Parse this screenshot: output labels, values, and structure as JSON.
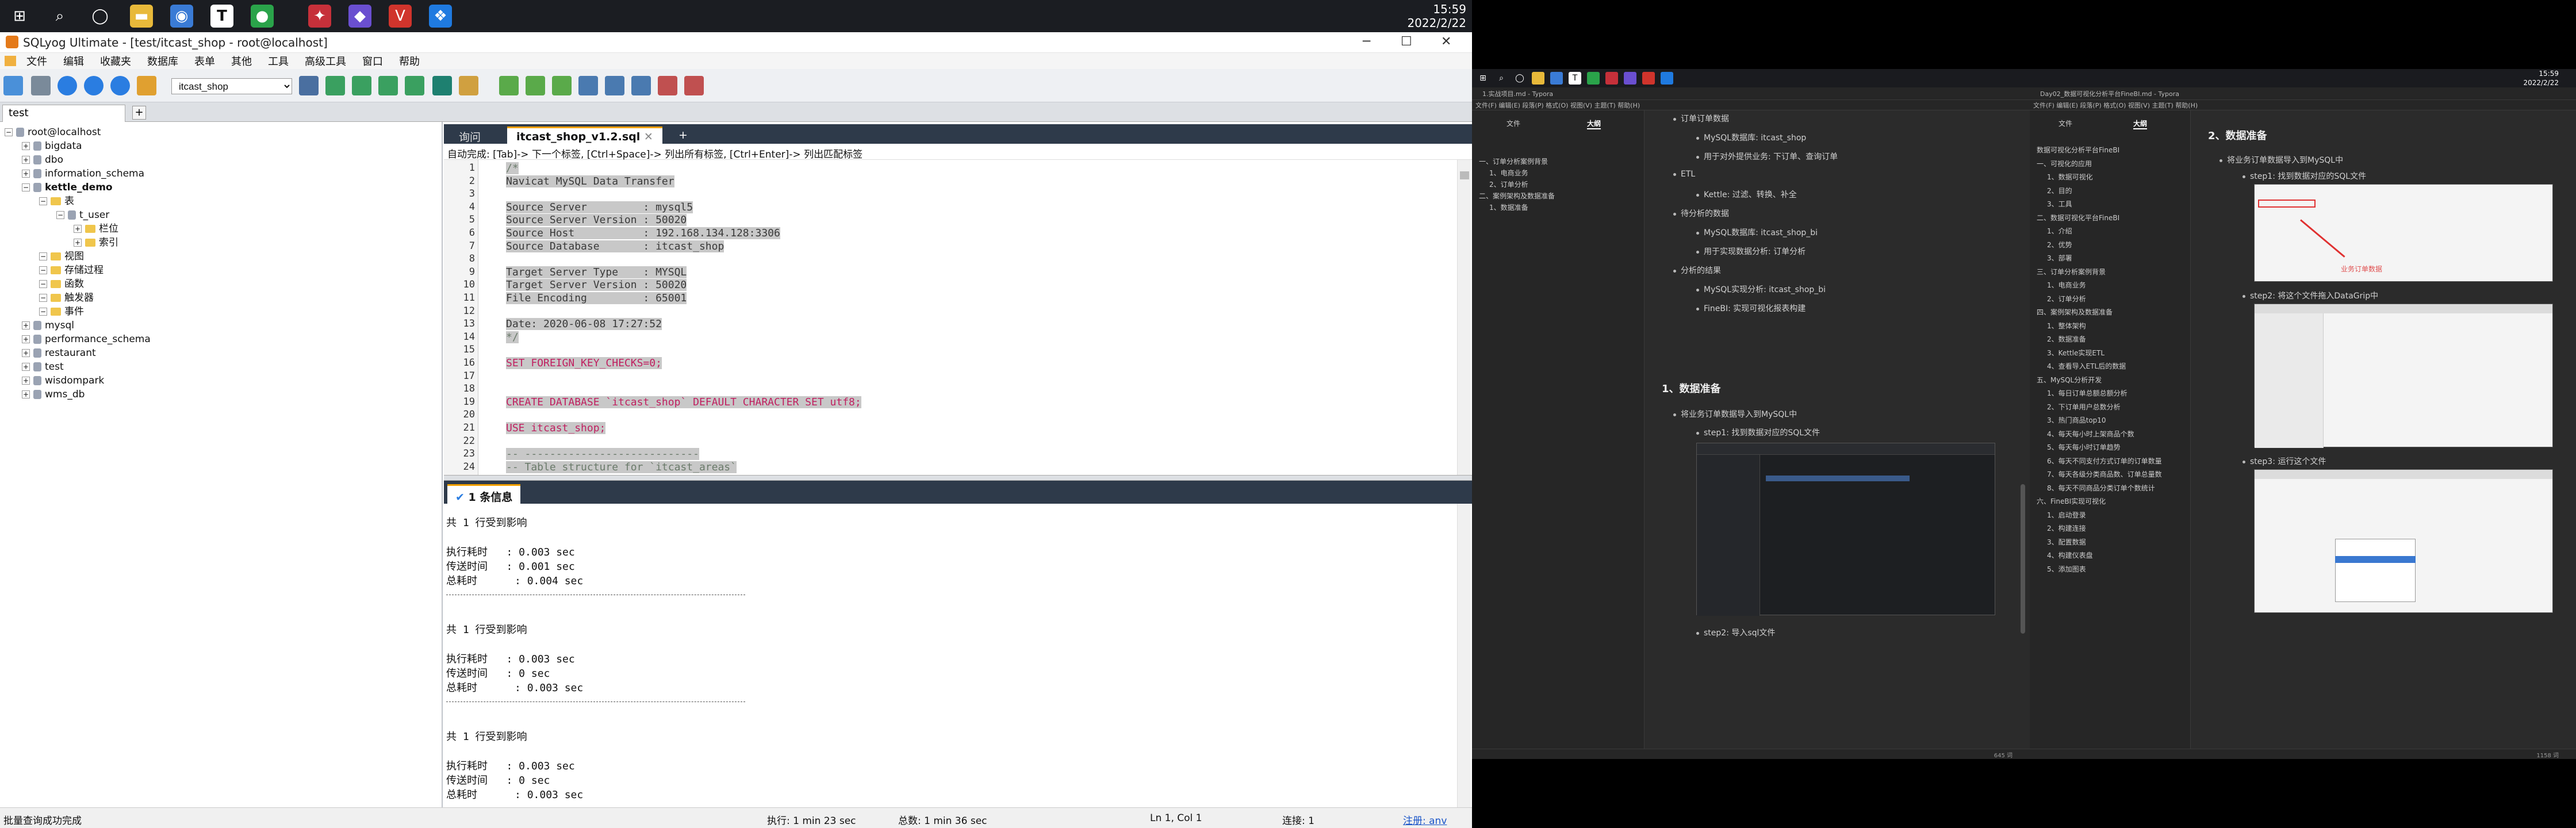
{
  "left": {
    "clock": {
      "time": "15:59",
      "date": "2022/2/22"
    },
    "title": "SQLyog Ultimate - [test/itcast_shop - root@localhost]",
    "menu": [
      "文件",
      "编辑",
      "收藏夹",
      "数据库",
      "表单",
      "其他",
      "工具",
      "高级工具",
      "窗口",
      "帮助"
    ],
    "db_select": "itcast_shop",
    "conn_tab": "test",
    "tree": [
      {
        "label": "root@localhost",
        "lvl": 0,
        "kind": "root"
      },
      {
        "label": "bigdata",
        "lvl": 1,
        "kind": "db"
      },
      {
        "label": "dbo",
        "lvl": 1,
        "kind": "db"
      },
      {
        "label": "information_schema",
        "lvl": 1,
        "kind": "db"
      },
      {
        "label": "kettle_demo",
        "lvl": 1,
        "kind": "db",
        "bold": true
      },
      {
        "label": "表",
        "lvl": 2,
        "kind": "fd"
      },
      {
        "label": "t_user",
        "lvl": 3,
        "kind": "tb"
      },
      {
        "label": "栏位",
        "lvl": 4,
        "kind": "fd"
      },
      {
        "label": "索引",
        "lvl": 4,
        "kind": "fd"
      },
      {
        "label": "视图",
        "lvl": 2,
        "kind": "fd"
      },
      {
        "label": "存储过程",
        "lvl": 2,
        "kind": "fd"
      },
      {
        "label": "函数",
        "lvl": 2,
        "kind": "fd"
      },
      {
        "label": "触发器",
        "lvl": 2,
        "kind": "fd"
      },
      {
        "label": "事件",
        "lvl": 2,
        "kind": "fd"
      },
      {
        "label": "mysql",
        "lvl": 1,
        "kind": "db"
      },
      {
        "label": "performance_schema",
        "lvl": 1,
        "kind": "db"
      },
      {
        "label": "restaurant",
        "lvl": 1,
        "kind": "db"
      },
      {
        "label": "test",
        "lvl": 1,
        "kind": "db"
      },
      {
        "label": "wisdompark",
        "lvl": 1,
        "kind": "db"
      },
      {
        "label": "wms_db",
        "lvl": 1,
        "kind": "db"
      }
    ],
    "editor_tabs": [
      "询问",
      "itcast_shop_v1.2.sql"
    ],
    "hint": "自动完成: [Tab]-> 下一个标签, [Ctrl+Space]-> 列出所有标签, [Ctrl+Enter]-> 列出匹配标签",
    "code": [
      "/*",
      "Navicat MySQL Data Transfer",
      "",
      "Source Server         : mysql5",
      "Source Server Version : 50020",
      "Source Host           : 192.168.134.128:3306",
      "Source Database       : itcast_shop",
      "",
      "Target Server Type    : MYSQL",
      "Target Server Version : 50020",
      "File Encoding         : 65001",
      "",
      "Date: 2020-06-08 17:27:52",
      "*/",
      "",
      "SET FOREIGN_KEY_CHECKS=0;",
      "",
      "",
      "CREATE DATABASE `itcast_shop` DEFAULT CHARACTER SET utf8;",
      "",
      "USE itcast_shop;",
      "",
      "-- ----------------------------",
      "-- Table structure for `itcast_areas`"
    ],
    "msg_tab": "1 条信息",
    "messages": [
      "共 1 行受到影响",
      "",
      "执行耗时   : 0.003 sec",
      "传送时间   : 0.001 sec",
      "总耗时      : 0.004 sec",
      "---",
      "共 1 行受到影响",
      "",
      "执行耗时   : 0.003 sec",
      "传送时间   : 0 sec",
      "总耗时      : 0.003 sec",
      "---",
      "共 1 行受到影响",
      "",
      "执行耗时   : 0.003 sec",
      "传送时间   : 0 sec",
      "总耗时      : 0.003 sec"
    ],
    "status": {
      "left": "批量查询成功完成",
      "exec": "执行: 1 min 23 sec",
      "total": "总数: 1 min 36 sec",
      "pos": "Ln 1, Col 1",
      "conn": "连接: 1",
      "reg": "注册: anv"
    }
  },
  "right": {
    "clock": {
      "time": "15:59",
      "date": "2022/2/22"
    },
    "win1": {
      "title": "1.实战项目.md - Typora",
      "menu": "文件(F)  编辑(E)  段落(P)  格式(O)  视图(V)  主题(T)  帮助(H)",
      "side_tabs": [
        "文件",
        "大纲"
      ],
      "outline": [
        "一、订单分析案例背景",
        "1、电商业务",
        "2、订单分析",
        "二、案例架构及数据准备",
        "1、数据准备"
      ],
      "doc": [
        {
          "t": "b",
          "text": "订单订单数据"
        },
        {
          "t": "c",
          "text": "MySQL数据库: itcast_shop"
        },
        {
          "t": "c",
          "text": "用于对外提供业务: 下订单、查询订单"
        },
        {
          "t": "b",
          "text": "ETL"
        },
        {
          "t": "c",
          "text": "Kettle: 过滤、转换、补全"
        },
        {
          "t": "b",
          "text": "待分析的数据"
        },
        {
          "t": "c",
          "text": "MySQL数据库: itcast_shop_bi"
        },
        {
          "t": "c",
          "text": "用于实现数据分析: 订单分析"
        },
        {
          "t": "b",
          "text": "分析的结果"
        },
        {
          "t": "c",
          "text": "MySQL实现分析: itcast_shop_bi"
        },
        {
          "t": "c",
          "text": "FineBI: 实现可视化报表构建"
        }
      ],
      "heading": "1、数据准备",
      "step_intro": "将业务订单数据导入到MySQL中",
      "step1": "step1: 找到数据对应的SQL文件",
      "step2": "step2: 导入sql文件",
      "words": "645 词"
    },
    "win2": {
      "title": "Day02_数据可视化分析平台FineBI.md - Typora",
      "menu": "文件(F)  编辑(E)  段落(P)  格式(O)  视图(V)  主题(T)  帮助(H)",
      "side_tabs": [
        "文件",
        "大纲"
      ],
      "outline": [
        "数据可视化分析平台FineBI",
        "一、可视化的应用",
        "1、数据可视化",
        "2、目的",
        "3、工具",
        "二、数据可视化平台FineBI",
        "1、介绍",
        "2、优势",
        "3、部署",
        "三、订单分析案例背景",
        "1、电商业务",
        "2、订单分析",
        "四、案例架构及数据准备",
        "1、整体架构",
        "2、数据准备",
        "3、Kettle实现ETL",
        "4、查看导入ETL后的数据",
        "五、MySQL分析开发",
        "1、每日订单总额总额分析",
        "2、下订单用户总数分析",
        "3、热门商品top10",
        "4、每天每小时上架商品个数",
        "5、每天每小时订单趋势",
        "6、每天不同支付方式订单的订单数量",
        "7、每天各级分类商品数、订单总量数",
        "8、每天不同商品分类订单个数统计",
        "六、FineBI实现可视化",
        "1、启动登录",
        "2、构建连接",
        "3、配置数据",
        "4、构建仪表盘",
        "5、添加图表"
      ],
      "heading": "2、数据准备",
      "step_intro": "将业务订单数据导入到MySQL中",
      "step1": "step1: 找到数据对应的SQL文件",
      "step2": "step2: 将这个文件拖入DataGrip中",
      "step3": "step3: 运行这个文件",
      "annot": "业务订单数据",
      "words": "1158 词"
    }
  }
}
